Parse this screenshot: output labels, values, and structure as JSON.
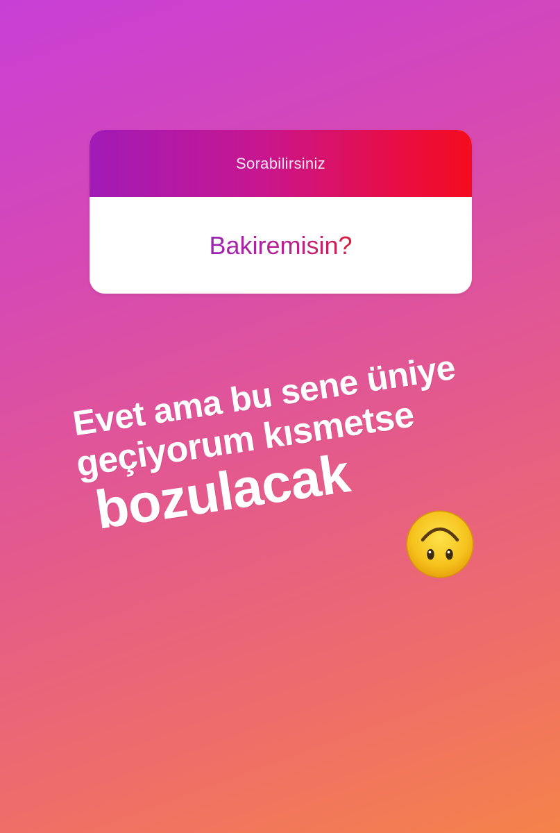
{
  "question_sticker": {
    "prompt": "Sorabilirsiniz",
    "question": "Bakiremisin?"
  },
  "answer": {
    "line_1": "Evet ama bu sene üniye",
    "line_2": "geçiyorum kısmetse",
    "line_3": "bozulacak"
  },
  "emoji": {
    "name": "upside-down-face-icon"
  },
  "colors": {
    "background_top": "#c83fd6",
    "background_bottom": "#f5834a",
    "header_start": "#a11bb7",
    "header_end": "#f40c1e",
    "question_text": "#b8238f",
    "answer_text": "#ffffff",
    "emoji_face": "#f6c21c"
  }
}
